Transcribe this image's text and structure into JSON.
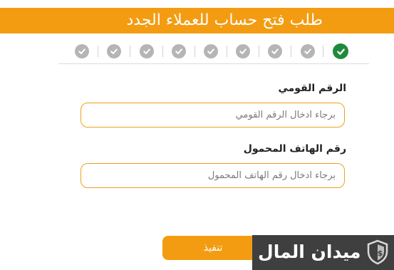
{
  "header": {
    "title": "طلب فتح حساب للعملاء الجدد"
  },
  "steps": {
    "count": 9,
    "completed": 1
  },
  "form": {
    "national_id": {
      "label": "الرقم القومي",
      "placeholder": "برجاء ادخال الرقم القومي",
      "value": ""
    },
    "mobile": {
      "label": "رقم الهاتف المحمول",
      "placeholder": "برجاء ادخال رقم الهاتف المحمول",
      "value": ""
    },
    "submit_label": "تنفيذ"
  },
  "watermark": {
    "name": "ميدان المال"
  },
  "colors": {
    "accent": "#f39c12",
    "step_done": "#1f8a3a",
    "step_pending": "#b5b5b5",
    "field_border": "#f0a020"
  },
  "icons": {
    "step": "check-icon",
    "brand": "shield-dollar-icon"
  }
}
